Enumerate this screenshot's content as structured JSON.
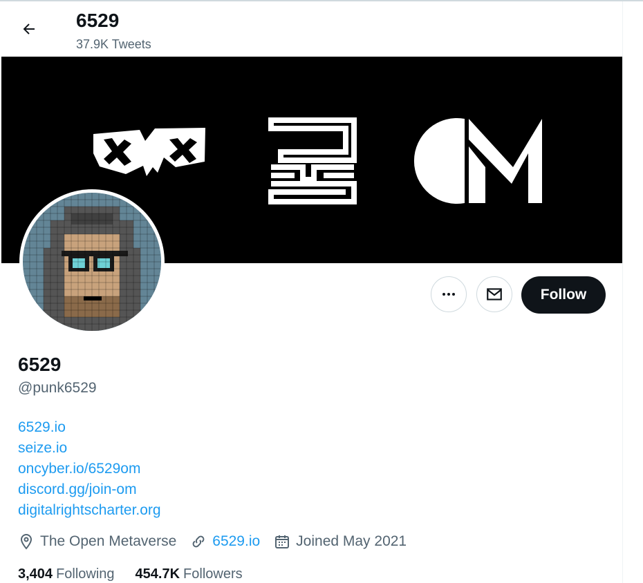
{
  "header": {
    "title": "6529",
    "tweet_count": "37.9K Tweets"
  },
  "icons": {
    "back": "arrow-left-icon",
    "more": "more-dots-icon",
    "message": "envelope-icon",
    "location": "location-pin-icon",
    "link": "link-icon",
    "calendar": "calendar-icon"
  },
  "actions": {
    "follow_label": "Follow"
  },
  "profile": {
    "name": "6529",
    "handle": "@punk6529",
    "bio_links": [
      "6529.io",
      "seize.io",
      "oncyber.io/6529om",
      "discord.gg/join-om",
      "digitalrightscharter.org"
    ],
    "location": "The Open Metaverse",
    "website": "6529.io",
    "joined": "Joined May 2021"
  },
  "stats": {
    "following_count": "3,404",
    "following_label": "Following",
    "followers_count": "454.7K",
    "followers_label": "Followers"
  },
  "colors": {
    "accent": "#1d9bf0",
    "text": "#0f1419",
    "secondary": "#536471",
    "banner": "#000000"
  }
}
